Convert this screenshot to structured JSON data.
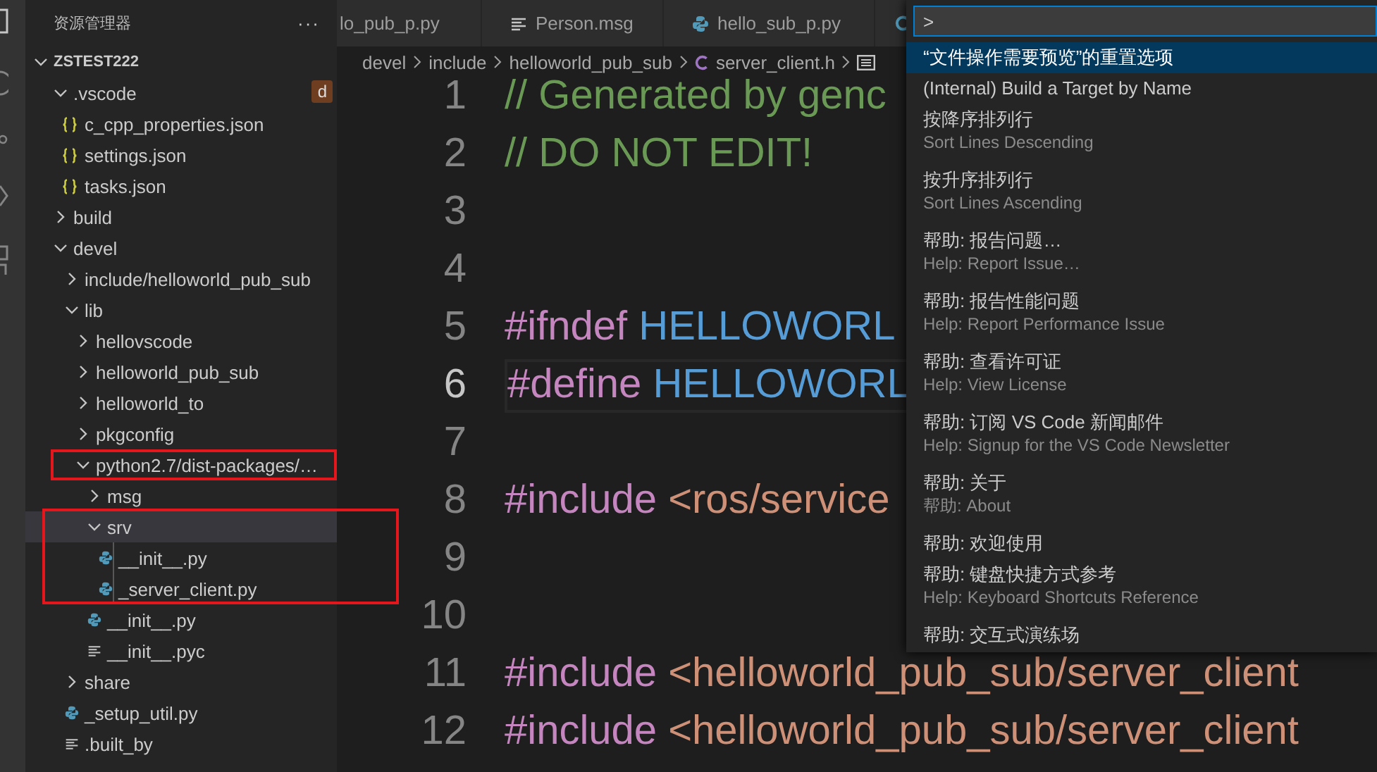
{
  "sidebar": {
    "title": "资源管理器",
    "more": "···",
    "find_text": "d",
    "tree": [
      {
        "label": "ZSTEST222",
        "kind": "root",
        "expanded": true,
        "selected": false,
        "boxed": false,
        "children": [
          {
            "label": ".vscode",
            "kind": "folder",
            "expanded": true,
            "selected": false,
            "boxed": false,
            "children": [
              {
                "label": "c_cpp_properties.json",
                "kind": "json",
                "selected": false,
                "boxed": false
              },
              {
                "label": "settings.json",
                "kind": "json",
                "selected": false,
                "boxed": false
              },
              {
                "label": "tasks.json",
                "kind": "json",
                "selected": false,
                "boxed": false
              }
            ]
          },
          {
            "label": "build",
            "kind": "folder",
            "expanded": false,
            "selected": false,
            "boxed": false
          },
          {
            "label": "devel",
            "kind": "folder",
            "expanded": true,
            "selected": false,
            "boxed": false,
            "children": [
              {
                "label": "include/helloworld_pub_sub",
                "kind": "folder",
                "expanded": false,
                "selected": false,
                "boxed": false
              },
              {
                "label": "lib",
                "kind": "folder",
                "expanded": true,
                "selected": false,
                "boxed": false,
                "children": [
                  {
                    "label": "hellovscode",
                    "kind": "folder",
                    "expanded": false,
                    "selected": false,
                    "boxed": false
                  },
                  {
                    "label": "helloworld_pub_sub",
                    "kind": "folder",
                    "expanded": false,
                    "selected": false,
                    "boxed": false
                  },
                  {
                    "label": "helloworld_to",
                    "kind": "folder",
                    "expanded": false,
                    "selected": false,
                    "boxed": false
                  },
                  {
                    "label": "pkgconfig",
                    "kind": "folder",
                    "expanded": false,
                    "selected": false,
                    "boxed": false
                  },
                  {
                    "label": "python2.7/dist-packages/…",
                    "kind": "folder",
                    "expanded": true,
                    "selected": false,
                    "boxed": true,
                    "children": [
                      {
                        "label": "msg",
                        "kind": "folder",
                        "expanded": false,
                        "selected": false,
                        "boxed": false
                      },
                      {
                        "label": "srv",
                        "kind": "folder",
                        "expanded": true,
                        "selected": true,
                        "boxed": true,
                        "children": [
                          {
                            "label": "__init__.py",
                            "kind": "python",
                            "selected": false,
                            "boxed": false
                          },
                          {
                            "label": "_server_client.py",
                            "kind": "python",
                            "selected": false,
                            "boxed": false
                          }
                        ]
                      },
                      {
                        "label": "__init__.py",
                        "kind": "python",
                        "selected": false,
                        "boxed": false
                      },
                      {
                        "label": "__init__.pyc",
                        "kind": "lines",
                        "selected": false,
                        "boxed": false
                      }
                    ]
                  }
                ]
              },
              {
                "label": "share",
                "kind": "folder",
                "expanded": false,
                "selected": false,
                "boxed": false
              },
              {
                "label": "_setup_util.py",
                "kind": "python",
                "selected": false,
                "boxed": false
              },
              {
                "label": ".built_by",
                "kind": "lines",
                "selected": false,
                "boxed": false
              }
            ]
          }
        ]
      }
    ]
  },
  "tabs": [
    {
      "label": "lo_pub_p.py",
      "kind": "none"
    },
    {
      "label": "Person.msg",
      "kind": "lines"
    },
    {
      "label": "hello_sub_p.py",
      "kind": "python"
    },
    {
      "kind": "c"
    }
  ],
  "breadcrumb": [
    {
      "label": "devel",
      "kind": "text"
    },
    {
      "label": "include",
      "kind": "text"
    },
    {
      "label": "helloworld_pub_sub",
      "kind": "text"
    },
    {
      "label": "server_client.h",
      "kind": "c"
    },
    {
      "kind": "symbol"
    }
  ],
  "editor": {
    "lines": [
      {
        "number": "1",
        "current": false,
        "tokens": [
          {
            "kind": "comment",
            "text": "// Generated by genc"
          }
        ]
      },
      {
        "number": "2",
        "current": false,
        "tokens": [
          {
            "kind": "comment",
            "text": "// DO NOT EDIT!"
          }
        ]
      },
      {
        "number": "3",
        "current": false
      },
      {
        "number": "4",
        "current": false
      },
      {
        "number": "5",
        "current": false,
        "tokens": [
          {
            "kind": "keyword",
            "text": "#ifndef"
          },
          {
            "kind": "macro",
            "text": "HELLOWORL"
          }
        ]
      },
      {
        "number": "6",
        "current": true,
        "tokens": [
          {
            "kind": "keyword",
            "text": "#define"
          },
          {
            "kind": "macro",
            "text": "HELLOWORL"
          }
        ]
      },
      {
        "number": "7",
        "current": false
      },
      {
        "number": "8",
        "current": false,
        "tokens": [
          {
            "kind": "keyword",
            "text": "#include"
          },
          {
            "kind": "string",
            "text": "<ros/service"
          }
        ]
      },
      {
        "number": "9",
        "current": false
      },
      {
        "number": "10",
        "current": false
      },
      {
        "number": "11",
        "current": false,
        "tokens": [
          {
            "kind": "keyword",
            "text": "#include"
          },
          {
            "kind": "string",
            "text": "<helloworld_pub_sub/server_client"
          }
        ]
      },
      {
        "number": "12",
        "current": false,
        "tokens": [
          {
            "kind": "keyword",
            "text": "#include"
          },
          {
            "kind": "string",
            "text": "<helloworld_pub_sub/server_client"
          }
        ]
      }
    ]
  },
  "command_palette": {
    "value": ">",
    "items": [
      {
        "label": "“文件操作需要预览”的重置选项",
        "selected": true
      },
      {
        "label": "(Internal) Build a Target by Name",
        "selected": false
      },
      {
        "label": "按降序排列行",
        "detail": "Sort Lines Descending",
        "selected": false
      },
      {
        "label": "按升序排列行",
        "detail": "Sort Lines Ascending",
        "selected": false
      },
      {
        "label": "帮助: 报告问题…",
        "detail": "Help: Report Issue…",
        "selected": false
      },
      {
        "label": "帮助: 报告性能问题",
        "detail": "Help: Report Performance Issue",
        "selected": false
      },
      {
        "label": "帮助: 查看许可证",
        "detail": "Help: View License",
        "selected": false
      },
      {
        "label": "帮助: 订阅 VS Code 新闻邮件",
        "detail": "Help: Signup for the VS Code Newsletter",
        "selected": false
      },
      {
        "label": "帮助: 关于",
        "detail": "帮助: About",
        "selected": false
      },
      {
        "label": "帮助: 欢迎使用",
        "selected": false
      },
      {
        "label": "帮助: 键盘快捷方式参考",
        "detail": "Help: Keyboard Shortcuts Reference",
        "selected": false
      },
      {
        "label": "帮助: 交互式演练场",
        "selected": false
      }
    ]
  }
}
